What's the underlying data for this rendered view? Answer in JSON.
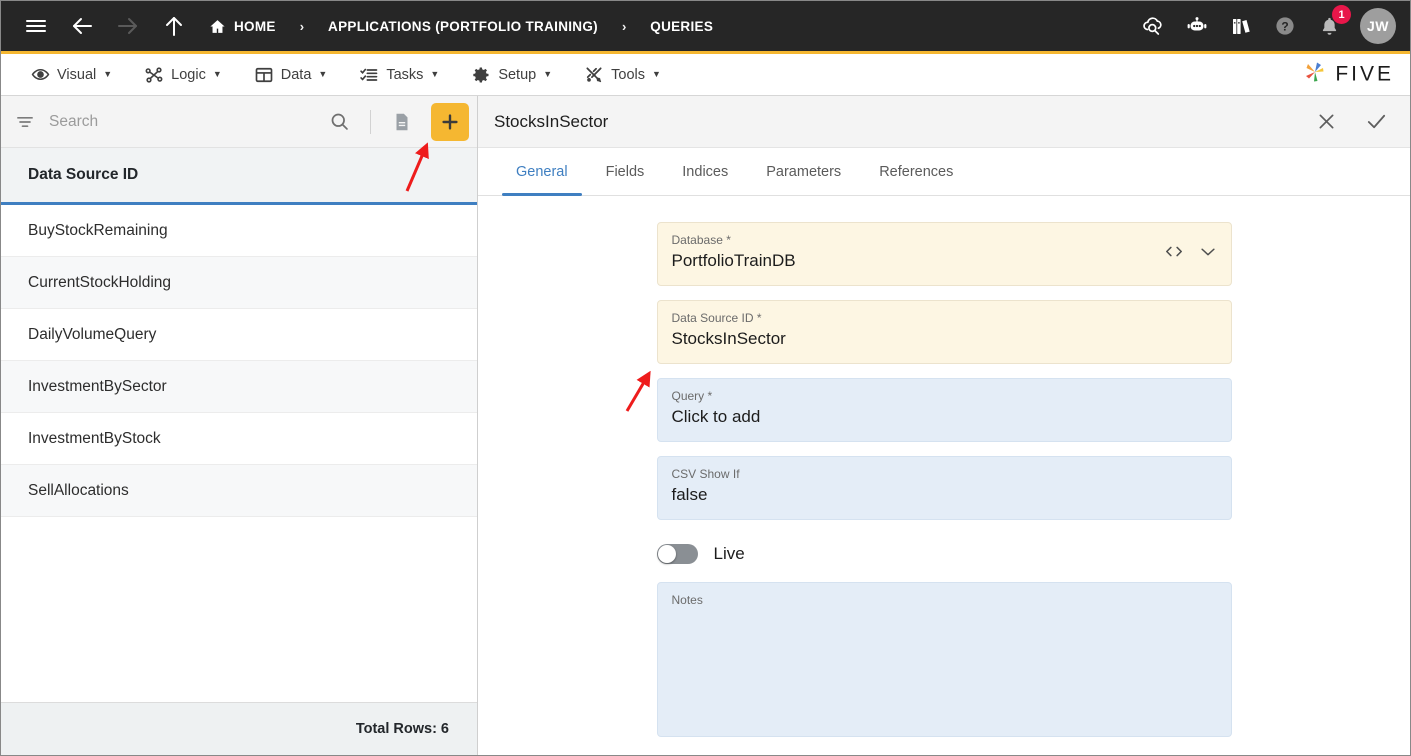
{
  "topbar": {
    "menu_icon": "hamburger-icon",
    "back_icon": "arrow-left-icon",
    "forward_icon": "arrow-right-icon",
    "up_icon": "arrow-up-icon",
    "breadcrumbs": [
      {
        "label": "HOME",
        "icon": "home-icon"
      },
      {
        "label": "APPLICATIONS (PORTFOLIO TRAINING)",
        "icon": ""
      },
      {
        "label": "QUERIES",
        "icon": ""
      }
    ],
    "separator": "›",
    "actions": [
      {
        "name": "cloud-search-icon"
      },
      {
        "name": "robot-chat-icon"
      },
      {
        "name": "books-icon"
      },
      {
        "name": "help-icon"
      }
    ],
    "notification_count": "1",
    "avatar_initials": "JW",
    "accent_color": "#F5B731",
    "bar_color": "#262626",
    "badge_color": "#E8174A"
  },
  "menubar": {
    "items": [
      {
        "label": "Visual",
        "icon": "eye-icon",
        "caret": "▼"
      },
      {
        "label": "Logic",
        "icon": "logic-nodes-icon",
        "caret": "▼"
      },
      {
        "label": "Data",
        "icon": "table-grid-icon",
        "caret": "▼"
      },
      {
        "label": "Tasks",
        "icon": "checklist-icon",
        "caret": "▼"
      },
      {
        "label": "Setup",
        "icon": "gear-icon",
        "caret": "▼"
      },
      {
        "label": "Tools",
        "icon": "tools-icon",
        "caret": "▼"
      }
    ],
    "brand": {
      "text": "FIVE",
      "mark": "five-pinwheel-logo"
    }
  },
  "sidebar": {
    "search": {
      "placeholder": "Search",
      "value": ""
    },
    "filter_icon": "filter-icon",
    "search_icon": "search-icon",
    "document_icon": "document-icon",
    "add_label": "+",
    "column_header": "Data Source ID",
    "rows": [
      {
        "label": "BuyStockRemaining"
      },
      {
        "label": "CurrentStockHolding"
      },
      {
        "label": "DailyVolumeQuery"
      },
      {
        "label": "InvestmentBySector"
      },
      {
        "label": "InvestmentByStock"
      },
      {
        "label": "SellAllocations"
      }
    ],
    "total_rows": "Total Rows: 6",
    "header_underline_color": "#3F7FC1"
  },
  "detail": {
    "title": "StocksInSector",
    "close_icon": "close-icon",
    "confirm_icon": "check-icon",
    "tabs": [
      {
        "label": "General",
        "active": true
      },
      {
        "label": "Fields",
        "active": false
      },
      {
        "label": "Indices",
        "active": false
      },
      {
        "label": "Parameters",
        "active": false
      },
      {
        "label": "References",
        "active": false
      }
    ],
    "active_tab_color": "#3F7FC1",
    "fields": [
      {
        "label": "Database *",
        "value": "PortfolioTrainDB",
        "style": "cream",
        "icons": [
          "code-brackets-icon",
          "chevron-down-icon"
        ]
      },
      {
        "label": "Data Source ID *",
        "value": "StocksInSector",
        "style": "cream",
        "icons": []
      },
      {
        "label": "Query *",
        "value": "Click to add",
        "style": "blue",
        "icons": []
      },
      {
        "label": "CSV Show If",
        "value": "false",
        "style": "blue",
        "icons": []
      }
    ],
    "toggle": {
      "label": "Live",
      "on": false
    },
    "notes": {
      "label": "Notes",
      "value": ""
    }
  },
  "annotations": {
    "color": "#EE1C1C",
    "arrows": [
      {
        "name": "arrow-to-add-button"
      },
      {
        "name": "arrow-to-query-field"
      }
    ]
  }
}
